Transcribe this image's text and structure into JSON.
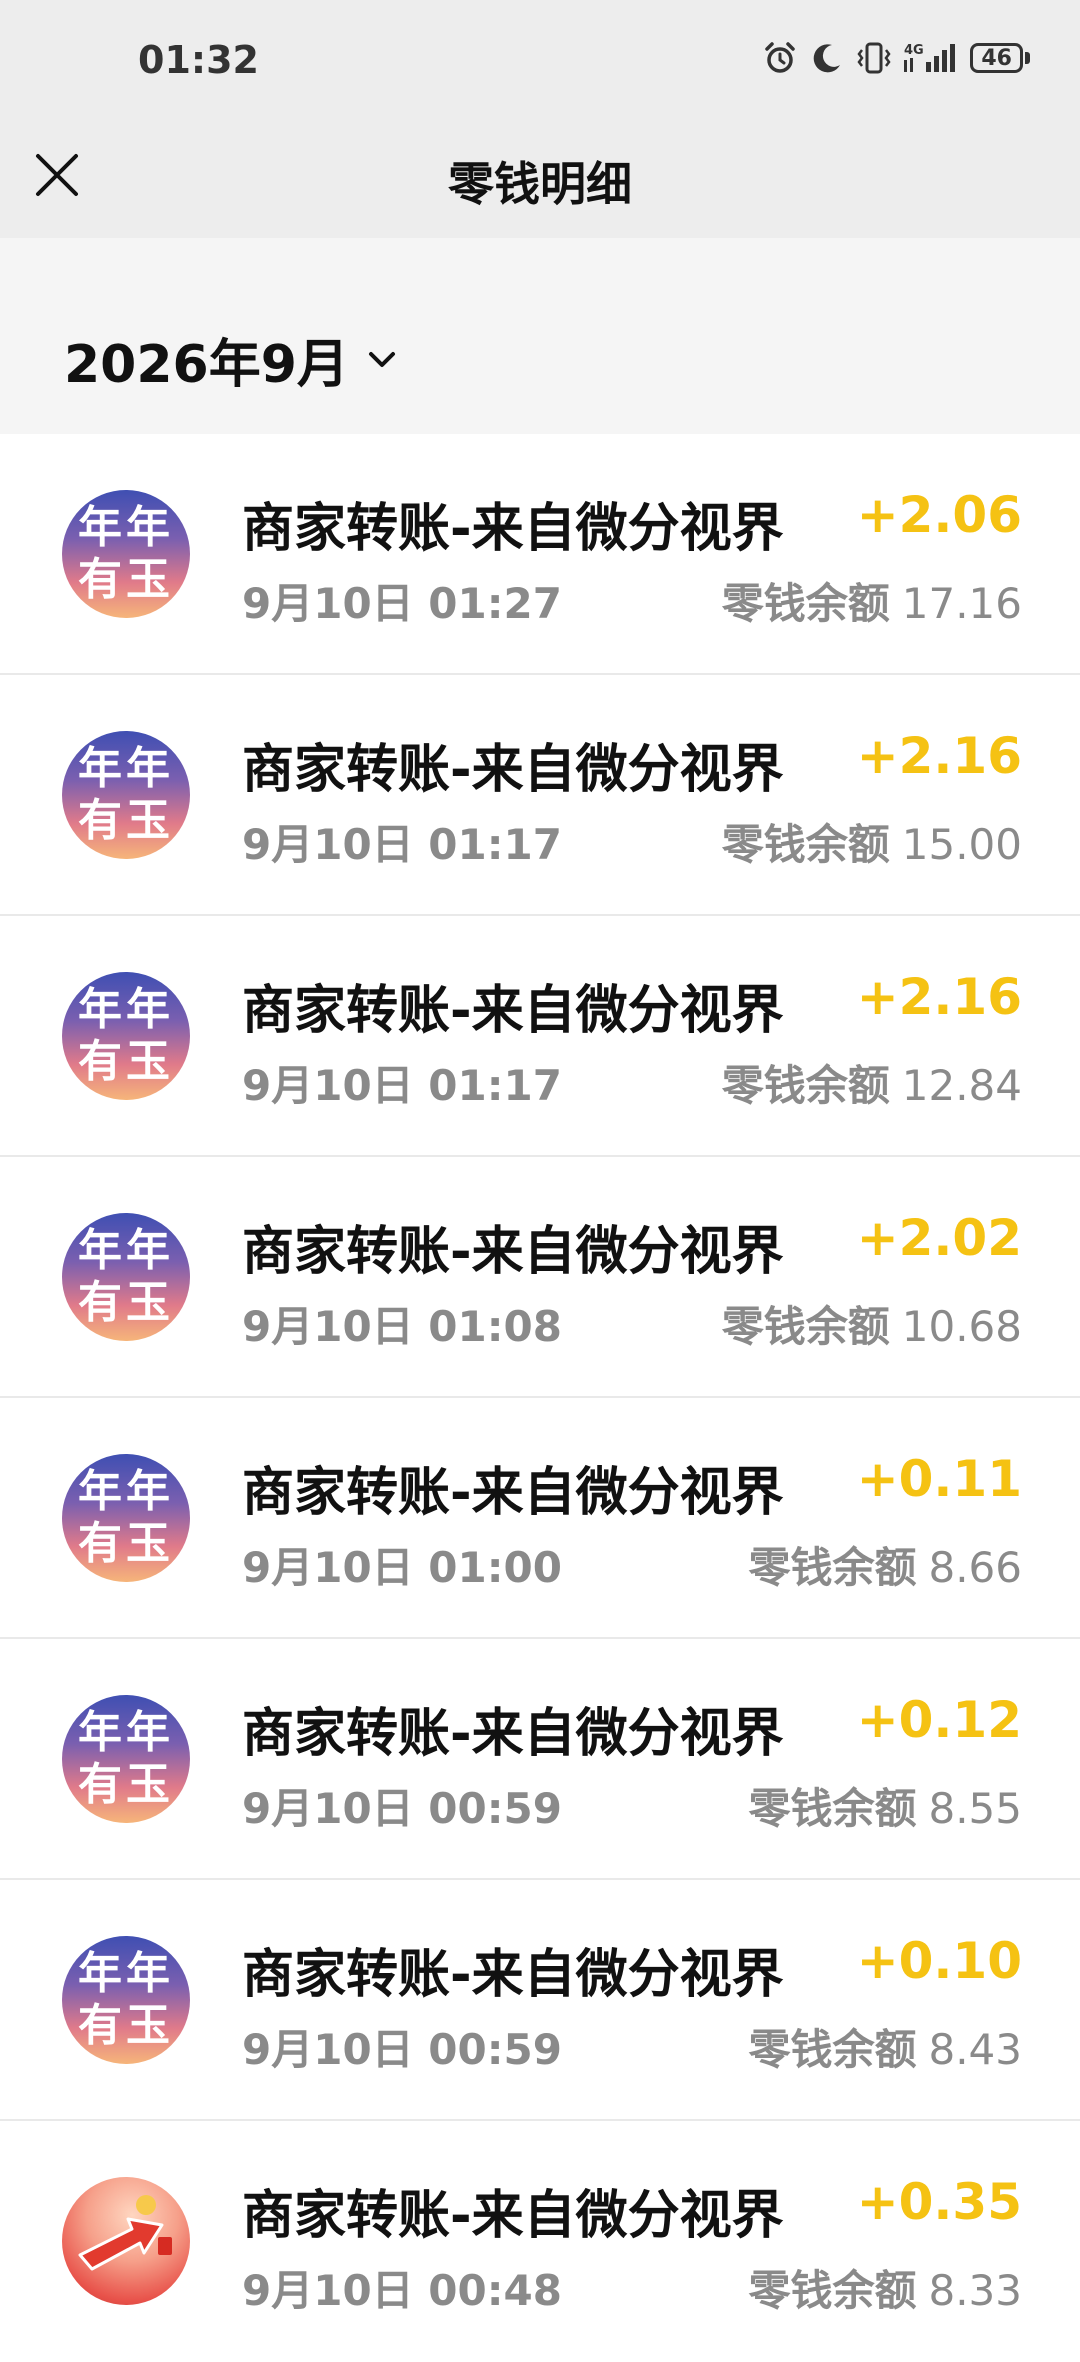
{
  "status_bar": {
    "time": "01:32",
    "network": "4G",
    "battery": "46",
    "icons": [
      "alarm-icon",
      "moon-icon",
      "vibrate-icon",
      "signal-icon",
      "battery-icon"
    ]
  },
  "header": {
    "title": "零钱明细",
    "close_icon": "close-icon"
  },
  "filter": {
    "month": "2026年9月",
    "dropdown_icon": "chevron-down-icon"
  },
  "colors": {
    "amount": "#f5c213",
    "secondary_text": "#8a8a8a",
    "top_bg": "#ededed",
    "month_bg": "#f5f5f5"
  },
  "transactions": [
    {
      "avatar_line1": "年年",
      "avatar_line2": "有玉",
      "title": "商家转账-来自微分视界",
      "amount": "+2.06",
      "datetime": "9月10日 01:27",
      "balance_label": "零钱余额",
      "balance": "17.16"
    },
    {
      "avatar_line1": "年年",
      "avatar_line2": "有玉",
      "title": "商家转账-来自微分视界",
      "amount": "+2.16",
      "datetime": "9月10日 01:17",
      "balance_label": "零钱余额",
      "balance": "15.00"
    },
    {
      "avatar_line1": "年年",
      "avatar_line2": "有玉",
      "title": "商家转账-来自微分视界",
      "amount": "+2.16",
      "datetime": "9月10日 01:17",
      "balance_label": "零钱余额",
      "balance": "12.84"
    },
    {
      "avatar_line1": "年年",
      "avatar_line2": "有玉",
      "title": "商家转账-来自微分视界",
      "amount": "+2.02",
      "datetime": "9月10日 01:08",
      "balance_label": "零钱余额",
      "balance": "10.68"
    },
    {
      "avatar_line1": "年年",
      "avatar_line2": "有玉",
      "title": "商家转账-来自微分视界",
      "amount": "+0.11",
      "datetime": "9月10日 01:00",
      "balance_label": "零钱余额",
      "balance": "8.66"
    },
    {
      "avatar_line1": "年年",
      "avatar_line2": "有玉",
      "title": "商家转账-来自微分视界",
      "amount": "+0.12",
      "datetime": "9月10日 00:59",
      "balance_label": "零钱余额",
      "balance": "8.55"
    },
    {
      "avatar_line1": "年年",
      "avatar_line2": "有玉",
      "title": "商家转账-来自微分视界",
      "amount": "+0.10",
      "datetime": "9月10日 00:59",
      "balance_label": "零钱余额",
      "balance": "8.43"
    },
    {
      "avatar_line1": "",
      "avatar_line2": "",
      "title": "商家转账-来自微分视界",
      "amount": "+0.35",
      "datetime": "9月10日 00:48",
      "balance_label": "零钱余额",
      "balance": "8.33"
    }
  ]
}
